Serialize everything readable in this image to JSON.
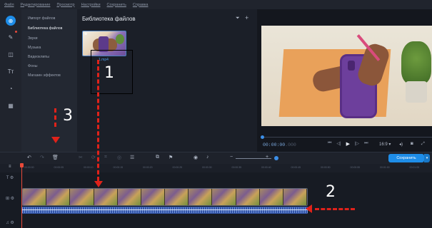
{
  "menu": [
    "Файл",
    "Редактирование",
    "Просмотр",
    "Настройки",
    "Сохранить",
    "Справка"
  ],
  "sidebar": {
    "items": [
      {
        "label": "Импорт файлов",
        "active": false
      },
      {
        "label": "Библиотека файлов",
        "active": true
      },
      {
        "label": "Звуки",
        "active": false
      },
      {
        "label": "Музыка",
        "active": false
      },
      {
        "label": "Видеоклипы",
        "active": false
      },
      {
        "label": "Фоны",
        "active": false
      },
      {
        "label": "Магазин эффектов",
        "active": false
      }
    ]
  },
  "library": {
    "title": "Библиотека файлов",
    "filter_icon": "filter-icon",
    "add_icon": "plus-icon",
    "file": {
      "name": "1.mp4"
    }
  },
  "preview": {
    "timecode_main": "00:00:00",
    "timecode_frac": ".000",
    "aspect_ratio": "16:9",
    "controls": [
      "skip-start-icon",
      "prev-frame-icon",
      "play-icon",
      "next-frame-icon",
      "skip-end-icon"
    ]
  },
  "toolbar": {
    "save_label": "Сохранить"
  },
  "ruler": {
    "ticks": [
      "00:00:00",
      "00:00:05",
      "00:00:10",
      "00:00:15",
      "00:00:20",
      "00:00:25",
      "00:00:30",
      "00:00:35",
      "00:00:40",
      "00:00:45",
      "00:00:50",
      "00:00:55",
      "00:01:00",
      "00:01:05"
    ]
  },
  "annotations": {
    "one": "1",
    "two": "2",
    "three": "3"
  },
  "colors": {
    "accent": "#1e8de8",
    "annotation_red": "#e0221a"
  }
}
